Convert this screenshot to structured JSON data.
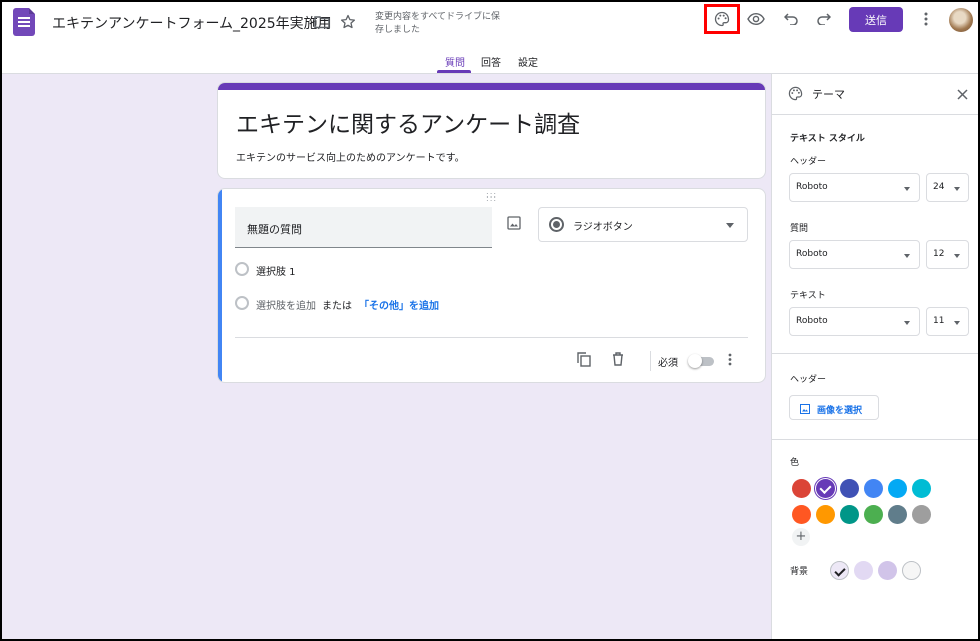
{
  "app": {
    "doc_title": "エキテンアンケートフォーム_2025年実施用",
    "save_status": "変更内容をすべてドライブに保存しました",
    "send_label": "送信"
  },
  "tabs": [
    {
      "label": "質問",
      "active": true
    },
    {
      "label": "回答",
      "active": false
    },
    {
      "label": "設定",
      "active": false
    }
  ],
  "form": {
    "title": "エキテンに関するアンケート調査",
    "description": "エキテンのサービス向上のためのアンケートです。"
  },
  "question": {
    "title": "無題の質問",
    "type": "ラジオボタン",
    "options": [
      "選択肢 1"
    ],
    "add_option": "選択肢を追加",
    "or": "または",
    "add_other": "「その他」を追加",
    "required_label": "必須",
    "required": false
  },
  "theme_panel": {
    "title": "テーマ",
    "text_style_label": "テキスト スタイル",
    "header_label": "ヘッダー",
    "header_font": "Roboto",
    "header_size": "24",
    "question_label": "質問",
    "question_font": "Roboto",
    "question_size": "12",
    "text_label": "テキスト",
    "text_font": "Roboto",
    "text_size": "11",
    "header_section_label": "ヘッダー",
    "select_image_label": "画像を選択",
    "color_label": "色",
    "colors": [
      "#db4437",
      "#673ab7",
      "#3f51b5",
      "#4285f4",
      "#03a9f4",
      "#00bcd4",
      "#ff5722",
      "#ff9800",
      "#009688",
      "#4caf50",
      "#607d8b",
      "#9e9e9e"
    ],
    "selected_color": "#673ab7",
    "background_label": "背景",
    "background_colors": [
      "#ede8f6",
      "#e2d9f3",
      "#d1c4e9",
      "#f6f6f6"
    ],
    "selected_background": "#ede8f6"
  }
}
